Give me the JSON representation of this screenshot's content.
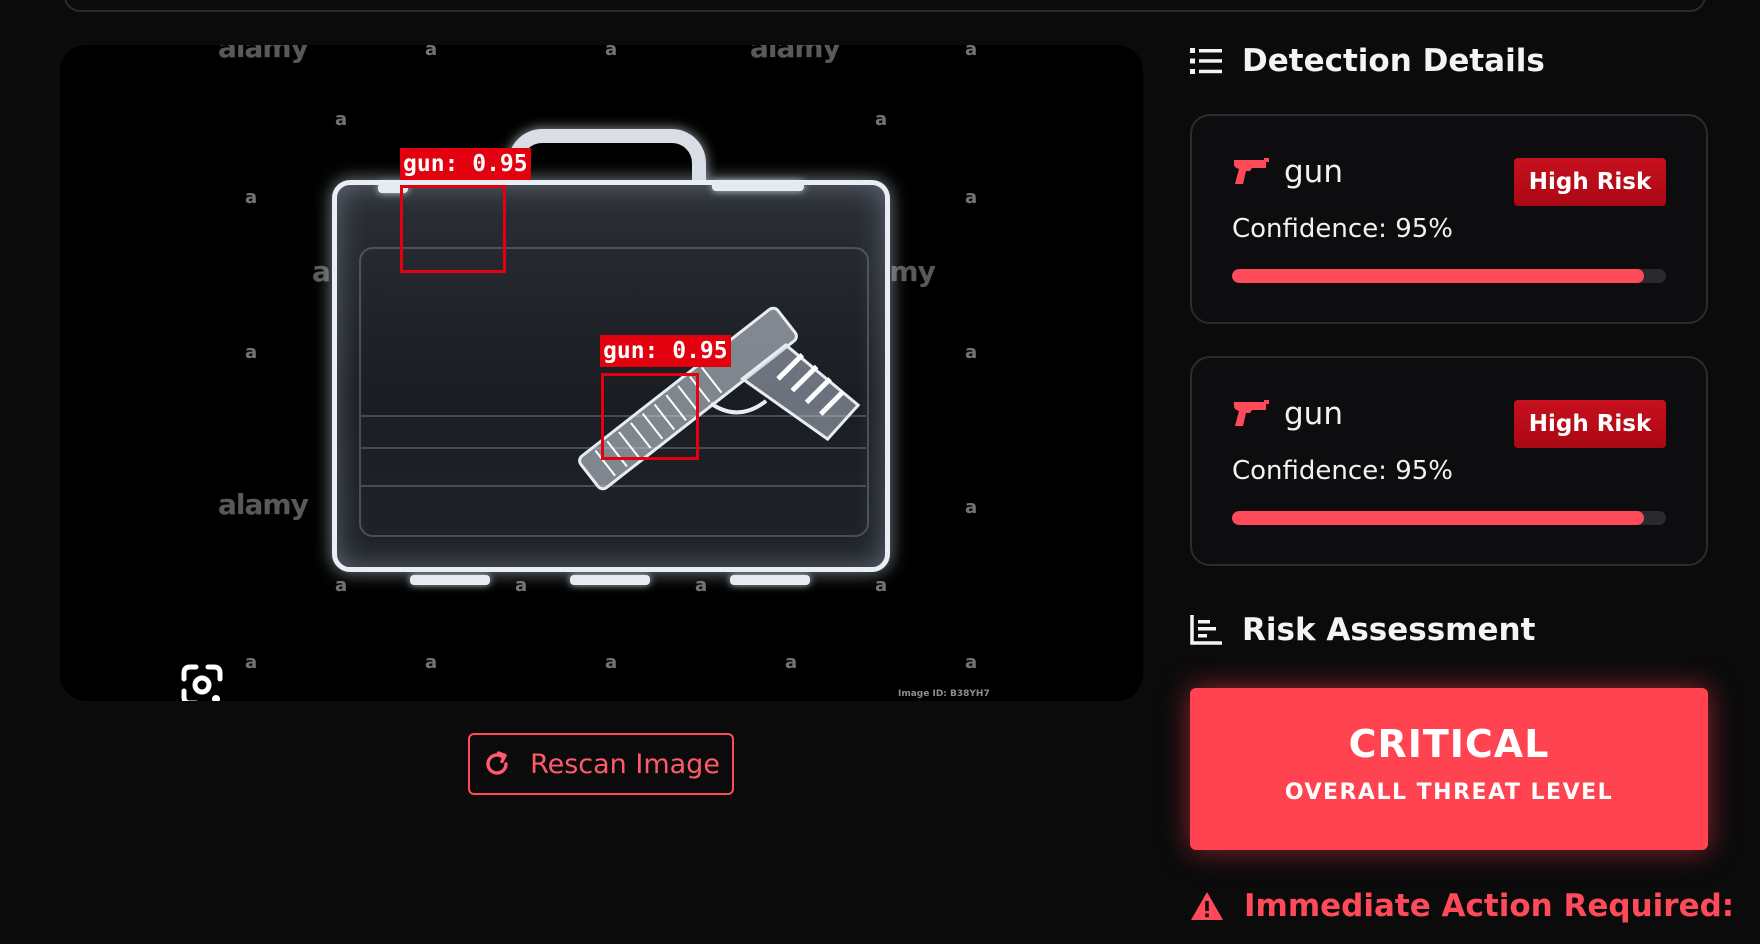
{
  "scan": {
    "watermark_big": "alamy",
    "watermark_small": "a",
    "image_id": "Image ID: B38YH7",
    "detections": [
      {
        "label": "gun:  0.95"
      },
      {
        "label": "gun:  0.95"
      }
    ]
  },
  "actions": {
    "rescan_label": "Rescan Image"
  },
  "detection_details": {
    "title": "Detection Details",
    "items": [
      {
        "name": "gun",
        "risk": "High Risk",
        "confidence_text": "Confidence: 95%",
        "confidence": 0.95
      },
      {
        "name": "gun",
        "risk": "High Risk",
        "confidence_text": "Confidence: 95%",
        "confidence": 0.95
      }
    ]
  },
  "risk_assessment": {
    "title": "Risk Assessment",
    "level": "CRITICAL",
    "caption": "OVERALL THREAT LEVEL",
    "alert_title": "Immediate Action Required:"
  },
  "colors": {
    "accent": "#ff4a5a",
    "badge": "#c8101e",
    "background": "#0b0b0c",
    "bbox": "#e3000f"
  }
}
